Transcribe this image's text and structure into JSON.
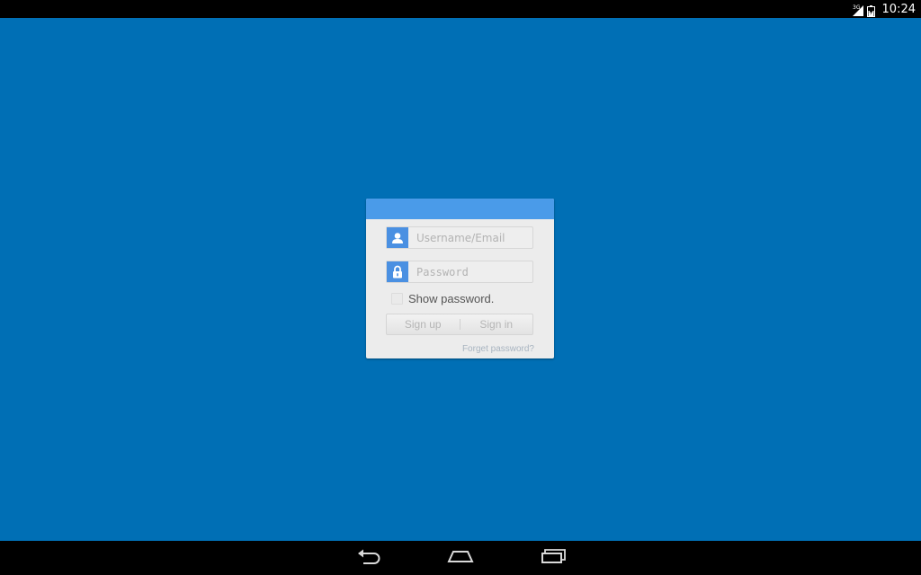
{
  "status_bar": {
    "network_label": "3G",
    "time": "10:24",
    "signal_icon": "signal-icon",
    "battery_icon": "battery-icon"
  },
  "colors": {
    "background": "#006fb5",
    "dialog_header": "#4a9be9",
    "field_icon": "#4a90e2"
  },
  "login": {
    "username": {
      "icon": "user-icon",
      "placeholder": "Username/Email",
      "value": ""
    },
    "password": {
      "icon": "lock-icon",
      "placeholder": "Password",
      "value": ""
    },
    "show_password": {
      "label": "Show password.",
      "checked": false
    },
    "buttons": {
      "sign_up": "Sign up",
      "sign_in": "Sign in"
    },
    "forget_password": "Forget password?"
  },
  "nav_bar": {
    "back_icon": "back-icon",
    "home_icon": "home-icon",
    "recent_apps_icon": "recent-apps-icon"
  }
}
